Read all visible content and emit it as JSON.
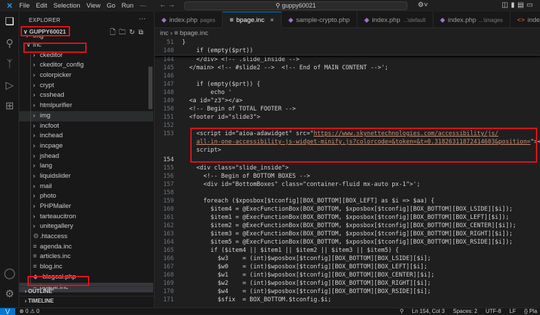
{
  "menu": [
    "File",
    "Edit",
    "Selection",
    "View",
    "Go",
    "Run",
    "···"
  ],
  "search": "guppy60021",
  "explorer": {
    "title": "EXPLORER",
    "root": "GUPPY60021",
    "tree": [
      {
        "label": "img",
        "type": "folder",
        "depth": 1,
        "state": "collapsed"
      },
      {
        "label": "inc",
        "type": "folder",
        "depth": 1,
        "state": "expanded"
      },
      {
        "label": "ckeditor",
        "type": "folder",
        "depth": 2
      },
      {
        "label": "ckeditor_config",
        "type": "folder",
        "depth": 2
      },
      {
        "label": "colorpicker",
        "type": "folder",
        "depth": 2
      },
      {
        "label": "crypt",
        "type": "folder",
        "depth": 2
      },
      {
        "label": "csshead",
        "type": "folder",
        "depth": 2
      },
      {
        "label": "htmlpurifier",
        "type": "folder",
        "depth": 2
      },
      {
        "label": "img",
        "type": "folder",
        "depth": 2
      },
      {
        "label": "incfoot",
        "type": "folder",
        "depth": 2
      },
      {
        "label": "inchead",
        "type": "folder",
        "depth": 2
      },
      {
        "label": "incpage",
        "type": "folder",
        "depth": 2
      },
      {
        "label": "jshead",
        "type": "folder",
        "depth": 2
      },
      {
        "label": "lang",
        "type": "folder",
        "depth": 2
      },
      {
        "label": "liquidslider",
        "type": "folder",
        "depth": 2
      },
      {
        "label": "mail",
        "type": "folder",
        "depth": 2
      },
      {
        "label": "photo",
        "type": "folder",
        "depth": 2
      },
      {
        "label": "PHPMailer",
        "type": "folder",
        "depth": 2
      },
      {
        "label": "tarteaucitron",
        "type": "folder",
        "depth": 2
      },
      {
        "label": "unitegallery",
        "type": "folder",
        "depth": 2
      },
      {
        "label": ".htaccess",
        "type": "gear",
        "depth": 2
      },
      {
        "label": "agenda.inc",
        "type": "file",
        "depth": 2
      },
      {
        "label": "articles.inc",
        "type": "file",
        "depth": 2
      },
      {
        "label": "blog.inc",
        "type": "file",
        "depth": 2
      },
      {
        "label": "blogcal.php",
        "type": "php",
        "depth": 2
      },
      {
        "label": "bpage.inc",
        "type": "file",
        "depth": 2
      }
    ],
    "outline": "OUTLINE",
    "timeline": "TIMELINE"
  },
  "tabs": [
    {
      "label": "index.php",
      "desc": "pages",
      "icon": "php"
    },
    {
      "label": "bpage.inc",
      "desc": "",
      "icon": "file",
      "active": true
    },
    {
      "label": "sample-crypto.php",
      "desc": "",
      "icon": "php"
    },
    {
      "label": "index.php",
      "desc": "...\\default",
      "icon": "php"
    },
    {
      "label": "index.php",
      "desc": "...\\images",
      "icon": "php"
    },
    {
      "label": "index.html",
      "desc": "",
      "icon": "html"
    }
  ],
  "breadcrumb": {
    "folder": "inc",
    "file": "bpage.inc"
  },
  "sticky": [
    {
      "n": "51",
      "t": "}"
    },
    {
      "n": "140",
      "t": "    if (empty($prt))"
    }
  ],
  "code": [
    {
      "n": "144",
      "t": "    </div> <!-- .slide_inside -->"
    },
    {
      "n": "145",
      "t": "  </main> <!-- #slide2 -->  <!-- End of MAIN CONTENT -->';"
    },
    {
      "n": "146",
      "t": ""
    },
    {
      "n": "147",
      "t": "    if (empty($prt)) {"
    },
    {
      "n": "148",
      "t": "        echo '"
    },
    {
      "n": "149",
      "t": "  <a id=\"z3\"></a>"
    },
    {
      "n": "150",
      "t": "  <!-- Begin of TOTAL FOOTER -->"
    },
    {
      "n": "151",
      "t": "  <footer id=\"slide3\">"
    },
    {
      "n": "152",
      "t": ""
    },
    {
      "n": "153",
      "t": "    <script id=\"aioa-adawidget\" src=\"",
      "url1": "https://www.skynettechnologies.com/accessibility/js/",
      "url2": "all-in-one-accessibility-js-widget-minify.js?colorcode=&token=&t=0.31826311872414603&position=",
      "t2": "\"></",
      "t3": "    script>"
    },
    {
      "n": "154",
      "t": ""
    },
    {
      "n": "155",
      "t": "    <div class=\"slide_inside\">"
    },
    {
      "n": "156",
      "t": "      <!-- Begin of BOTTOM BOXES -->"
    },
    {
      "n": "157",
      "t": "      <div id=\"BottomBoxes\" class=\"container-fluid mx-auto px-1\">';"
    },
    {
      "n": "158",
      "t": ""
    },
    {
      "n": "159",
      "t": "      foreach ($xposbox[$tconfig][BOX_BOTTOM][BOX_LEFT] as $i => $aa) {"
    },
    {
      "n": "160",
      "t": "        $item4 = @ExecFunctionBox(BOX_BOTTOM, $xposbox[$tconfig][BOX_BOTTOM][BOX_LSIDE][$i]);"
    },
    {
      "n": "161",
      "t": "        $item1 = @ExecFunctionBox(BOX_BOTTOM, $xposbox[$tconfig][BOX_BOTTOM][BOX_LEFT][$i]);"
    },
    {
      "n": "162",
      "t": "        $item2 = @ExecFunctionBox(BOX_BOTTOM, $xposbox[$tconfig][BOX_BOTTOM][BOX_CENTER][$i]);"
    },
    {
      "n": "163",
      "t": "        $item3 = @ExecFunctionBox(BOX_BOTTOM, $xposbox[$tconfig][BOX_BOTTOM][BOX_RIGHT][$i]);"
    },
    {
      "n": "164",
      "t": "        $item5 = @ExecFunctionBox(BOX_BOTTOM, $xposbox[$tconfig][BOX_BOTTOM][BOX_RSIDE][$i]);"
    },
    {
      "n": "165",
      "t": "        if ($item4 || $item1 || $item2 || $item3 || $item5) {"
    },
    {
      "n": "166",
      "t": "          $w3    = (int)$wposbox[$tconfig][BOX_BOTTOM][BOX_LSIDE][$i];"
    },
    {
      "n": "167",
      "t": "          $w0    = (int)$wposbox[$tconfig][BOX_BOTTOM][BOX_LEFT][$i];"
    },
    {
      "n": "168",
      "t": "          $w1    = (int)$wposbox[$tconfig][BOX_BOTTOM][BOX_CENTER][$i];"
    },
    {
      "n": "169",
      "t": "          $w2    = (int)$wposbox[$tconfig][BOX_BOTTOM][BOX_RIGHT][$i];"
    },
    {
      "n": "170",
      "t": "          $w4    = (int)$wposbox[$tconfig][BOX_BOTTOM][BOX_RSIDE][$i];"
    },
    {
      "n": "171",
      "t": "          $sfix  = BOX_BOTTOM.$tconfig.$i;"
    }
  ],
  "status": {
    "errors": "0",
    "warnings": "0",
    "position": "Ln 154, Col 3",
    "spaces": "Spaces: 2",
    "encoding": "UTF-8",
    "eol": "LF",
    "language": "{} Pla"
  }
}
